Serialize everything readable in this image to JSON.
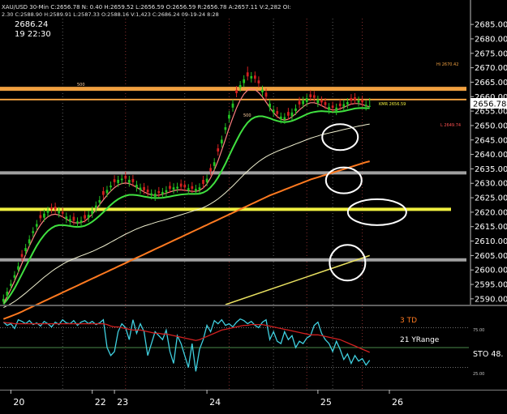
{
  "header": {
    "line1": "XAU/USD 30-Min  C:2656.78  N: 0.40  H:2659.52  L:2656.59  O:2656.59  R:2656.78  A:2657.11  V:2,282  OI:",
    "line2": "2.30  C:2588.90  H:2589.91  L:2587.33  O:2588.16  V:1,423  C:2686.24  09-19-24  8:28",
    "cursor_price": "2686.24",
    "cursor_time": "19 22:30"
  },
  "price_axis": {
    "ticks": [
      "2685.00",
      "2680.00",
      "2675.00",
      "2670.00",
      "2665.00",
      "2660.00",
      "2655.00",
      "2650.00",
      "2645.00",
      "2640.00",
      "2635.00",
      "2630.00",
      "2625.00",
      "2620.00",
      "2615.00",
      "2610.00",
      "2605.00",
      "2600.00",
      "2595.00",
      "2590.00"
    ],
    "last_price": "2656.78"
  },
  "price_annotations": {
    "high_label": "Hi 2670.42",
    "mid_label": "KMR  2656.59",
    "low_label": "L  2649.74",
    "small_label_1": "500",
    "small_label_2": "500"
  },
  "indicator": {
    "label_td": "3 TD",
    "label_range": "21 YRange",
    "label_sto": "STO  48.",
    "level_high": "75.00",
    "level_low": "25.00"
  },
  "date_axis": {
    "labels": [
      "20",
      "22",
      "23",
      "24",
      "25",
      "26"
    ]
  },
  "colors": {
    "background": "#000000",
    "up_candle": "#22c322",
    "down_candle": "#d42020",
    "grid": "#7a7a7a",
    "hline_orange": "#f0a040",
    "hline_yellow": "#f0f040",
    "hline_gray": "#a0a0a0",
    "ma_fast": "#ff8080",
    "ma_mid": "#40e040",
    "ma_slow": "#f0f0d0",
    "ma_orange": "#ff7a20",
    "ma_yellow": "#e8e060",
    "oscillator": "#40d0e0",
    "oscillator_signal": "#d02020",
    "circle": "#ffffff"
  },
  "chart_data": {
    "type": "line",
    "title": "XAU/USD 30-Min",
    "y_range": [
      2588,
      2687
    ],
    "candles": {
      "close": [
        2590.0,
        2592.5,
        2595.2,
        2598.2,
        2601.3,
        2604.5,
        2607.6,
        2610.6,
        2613.4,
        2615.9,
        2617.9,
        2619.5,
        2620.5,
        2621.0,
        2620.9,
        2620.4,
        2619.5,
        2618.5,
        2617.6,
        2617.0,
        2616.8,
        2617.1,
        2617.8,
        2619.1,
        2620.6,
        2622.3,
        2624.2,
        2626.0,
        2627.7,
        2629.2,
        2630.4,
        2631.2,
        2631.6,
        2631.6,
        2631.2,
        2630.4,
        2629.5,
        2628.5,
        2627.6,
        2626.9,
        2626.5,
        2626.4,
        2626.6,
        2627.0,
        2627.6,
        2628.1,
        2628.6,
        2628.8,
        2628.8,
        2628.6,
        2628.3,
        2628.1,
        2628.1,
        2628.6,
        2629.8,
        2631.6,
        2634.1,
        2637.3,
        2641.0,
        2645.1,
        2649.4,
        2653.7,
        2657.6,
        2661.2,
        2664.0,
        2666.0,
        2667.0,
        2667.1,
        2666.2,
        2664.6,
        2662.4,
        2660.0,
        2657.6,
        2655.5,
        2654.0,
        2653.1,
        2652.9,
        2653.4,
        2654.5,
        2655.9,
        2657.3,
        2658.6,
        2659.5,
        2659.8,
        2659.6,
        2658.9,
        2658.0,
        2657.1,
        2656.4,
        2656.1,
        2656.2,
        2656.7,
        2657.4,
        2658.1,
        2658.6,
        2658.8,
        2658.6,
        2658.0,
        2657.2,
        2656.78
      ],
      "open": [
        2589.0,
        2591.1,
        2594.5,
        2597.3,
        2600.1,
        2605.5,
        2606.5,
        2609.2,
        2612.8,
        2615.0,
        2619.0,
        2618.1,
        2619.8,
        2621.6,
        2621.9,
        2619.6,
        2620.1,
        2617.6,
        2616.7,
        2618.4,
        2616.2,
        2616.4,
        2619.0,
        2618.0,
        2619.4,
        2621.6,
        2623.3,
        2627.3,
        2626.6,
        2628.6,
        2631.4,
        2630.1,
        2631.1,
        2632.6,
        2630.2,
        2631.5,
        2628.5,
        2627.7,
        2628.7,
        2627.8,
        2625.8,
        2625.3,
        2627.3,
        2626.2,
        2626.9,
        2629.1,
        2627.8,
        2628.2,
        2629.9,
        2629.5,
        2627.5,
        2629.0,
        2627.4,
        2627.7,
        2631.2,
        2630.4,
        2635.3,
        2636.0,
        2642.1,
        2643.8,
        2648.5,
        2652.4,
        2656.2,
        2662.3,
        2663.1,
        2664.7,
        2668.4,
        2666.3,
        2667.3,
        2665.6,
        2661.5,
        2661.4,
        2656.3,
        2654.4,
        2655.0,
        2652.1,
        2652.0,
        2654.7,
        2653.2,
        2655.0,
        2658.5,
        2657.4,
        2658.1,
        2660.8,
        2660.5,
        2657.8,
        2658.7,
        2658.1,
        2655.4,
        2656.9,
        2655.0,
        2657.6,
        2656.5,
        2657.3,
        2659.5,
        2659.8,
        2658.0,
        2658.9,
        2656.6,
        2656.59
      ],
      "high": [
        2591.5,
        2593.9,
        2596.6,
        2599.6,
        2602.7,
        2606.9,
        2609.0,
        2612.0,
        2614.8,
        2617.3,
        2620.4,
        2620.9,
        2621.9,
        2623.0,
        2623.3,
        2621.8,
        2621.5,
        2619.9,
        2619.0,
        2619.8,
        2618.2,
        2618.5,
        2620.4,
        2620.5,
        2622.0,
        2623.7,
        2625.6,
        2628.7,
        2629.1,
        2630.6,
        2632.8,
        2632.6,
        2633.0,
        2634.0,
        2632.6,
        2632.9,
        2630.9,
        2629.9,
        2630.1,
        2629.2,
        2627.9,
        2627.8,
        2628.7,
        2628.4,
        2629.0,
        2630.5,
        2630.0,
        2630.2,
        2631.3,
        2630.9,
        2629.7,
        2630.4,
        2629.5,
        2630.0,
        2632.6,
        2633.0,
        2636.7,
        2638.7,
        2643.5,
        2646.5,
        2650.8,
        2655.1,
        2659.0,
        2663.7,
        2665.4,
        2667.4,
        2670.4,
        2668.5,
        2668.7,
        2667.0,
        2663.8,
        2662.8,
        2659.0,
        2656.9,
        2656.4,
        2654.5,
        2654.3,
        2656.1,
        2655.9,
        2657.3,
        2659.9,
        2660.0,
        2660.9,
        2662.2,
        2661.9,
        2660.3,
        2660.1,
        2659.5,
        2657.8,
        2658.3,
        2657.6,
        2659.0,
        2658.8,
        2659.5,
        2660.9,
        2661.2,
        2660.0,
        2660.3,
        2658.6,
        2659.52
      ],
      "low": [
        2588.2,
        2590.1,
        2593.3,
        2596.3,
        2599.0,
        2603.1,
        2605.1,
        2608.2,
        2611.4,
        2613.6,
        2616.5,
        2616.7,
        2618.4,
        2619.6,
        2619.5,
        2618.2,
        2618.1,
        2616.2,
        2615.3,
        2615.6,
        2614.8,
        2615.0,
        2616.4,
        2616.6,
        2618.0,
        2619.9,
        2621.9,
        2624.6,
        2625.2,
        2627.2,
        2629.0,
        2628.7,
        2629.7,
        2630.2,
        2628.8,
        2628.9,
        2627.1,
        2626.3,
        2626.2,
        2625.5,
        2624.4,
        2623.9,
        2625.2,
        2624.8,
        2625.5,
        2626.7,
        2626.4,
        2626.8,
        2627.4,
        2627.2,
        2626.1,
        2626.7,
        2626.0,
        2626.3,
        2628.4,
        2629.0,
        2632.7,
        2634.6,
        2639.6,
        2642.4,
        2647.1,
        2651.0,
        2654.8,
        2659.8,
        2661.7,
        2663.3,
        2665.6,
        2664.9,
        2664.8,
        2663.2,
        2660.1,
        2658.6,
        2654.9,
        2653.0,
        2652.6,
        2650.7,
        2650.6,
        2652.0,
        2651.8,
        2653.6,
        2655.9,
        2656.0,
        2656.7,
        2658.4,
        2658.2,
        2656.4,
        2656.6,
        2655.7,
        2654.0,
        2654.7,
        2653.6,
        2655.3,
        2655.1,
        2655.9,
        2657.2,
        2657.4,
        2656.6,
        2656.6,
        2655.2,
        2656.59
      ]
    },
    "moving_averages": {
      "ma_fast": [
        2588.5,
        2590.8,
        2593.4,
        2596.2,
        2599.2,
        2602.3,
        2605.3,
        2608.3,
        2611.0,
        2613.5,
        2615.6,
        2617.3,
        2618.4,
        2619.1,
        2619.3,
        2619.0,
        2618.4,
        2617.6,
        2616.9,
        2616.4,
        2616.2,
        2616.4,
        2616.9,
        2618.0,
        2619.3,
        2620.9,
        2622.6,
        2624.3,
        2625.9,
        2627.3,
        2628.5,
        2629.4,
        2629.9,
        2630.1,
        2629.9,
        2629.3,
        2628.6,
        2627.8,
        2627.0,
        2626.4,
        2626.0,
        2625.8,
        2625.9,
        2626.2,
        2626.6,
        2627.0,
        2627.4,
        2627.7,
        2627.7,
        2627.6,
        2627.4,
        2627.2,
        2627.2,
        2627.5,
        2628.4,
        2629.8,
        2631.9,
        2634.6,
        2637.8,
        2641.4,
        2645.2,
        2649.1,
        2652.7,
        2656.1,
        2658.8,
        2660.9,
        2662.2,
        2662.7,
        2662.4,
        2661.4,
        2659.9,
        2658.1,
        2656.2,
        2654.4,
        2653.1,
        2652.2,
        2651.9,
        2652.2,
        2653.0,
        2654.1,
        2655.4,
        2656.5,
        2657.4,
        2657.9,
        2657.9,
        2657.5,
        2656.9,
        2656.2,
        2655.7,
        2655.4,
        2655.4,
        2655.8,
        2656.3,
        2656.9,
        2657.4,
        2657.6,
        2657.6,
        2657.3,
        2656.8,
        2656.5
      ],
      "ma_mid": [
        2588.2,
        2589.7,
        2591.6,
        2593.7,
        2596.1,
        2598.6,
        2601.1,
        2603.6,
        2606.1,
        2608.4,
        2610.4,
        2612.1,
        2613.5,
        2614.5,
        2615.2,
        2615.5,
        2615.5,
        2615.4,
        2615.2,
        2615.0,
        2614.9,
        2615.0,
        2615.3,
        2615.9,
        2616.7,
        2617.7,
        2618.8,
        2620.0,
        2621.3,
        2622.5,
        2623.6,
        2624.5,
        2625.2,
        2625.7,
        2626.0,
        2626.0,
        2625.9,
        2625.7,
        2625.4,
        2625.2,
        2625.0,
        2624.9,
        2624.9,
        2625.0,
        2625.2,
        2625.4,
        2625.7,
        2625.9,
        2626.1,
        2626.2,
        2626.3,
        2626.3,
        2626.3,
        2626.4,
        2626.8,
        2627.5,
        2628.6,
        2630.1,
        2632.0,
        2634.3,
        2636.8,
        2639.5,
        2642.2,
        2644.8,
        2647.2,
        2649.3,
        2651.0,
        2652.2,
        2652.9,
        2653.2,
        2653.2,
        2652.9,
        2652.5,
        2652.0,
        2651.6,
        2651.3,
        2651.2,
        2651.3,
        2651.6,
        2652.1,
        2652.7,
        2653.3,
        2653.9,
        2654.4,
        2654.7,
        2654.9,
        2655.0,
        2654.9,
        2654.8,
        2654.7,
        2654.7,
        2654.8,
        2655.0,
        2655.3,
        2655.6,
        2655.9,
        2656.0,
        2656.1,
        2656.0,
        2656.0
      ],
      "ma_slow": [
        2587.0,
        2587.6,
        2588.3,
        2589.1,
        2590.0,
        2591.0,
        2592.0,
        2593.1,
        2594.2,
        2595.3,
        2596.4,
        2597.5,
        2598.5,
        2599.5,
        2600.4,
        2601.2,
        2602.0,
        2602.7,
        2603.3,
        2603.9,
        2604.4,
        2604.9,
        2605.4,
        2605.9,
        2606.4,
        2607.0,
        2607.6,
        2608.2,
        2608.9,
        2609.6,
        2610.3,
        2611.0,
        2611.7,
        2612.4,
        2613.0,
        2613.6,
        2614.2,
        2614.7,
        2615.2,
        2615.6,
        2616.0,
        2616.4,
        2616.8,
        2617.1,
        2617.5,
        2617.9,
        2618.3,
        2618.7,
        2619.1,
        2619.5,
        2619.9,
        2620.3,
        2620.7,
        2621.1,
        2621.6,
        2622.2,
        2622.9,
        2623.7,
        2624.6,
        2625.6,
        2626.7,
        2627.9,
        2629.1,
        2630.4,
        2631.7,
        2633.0,
        2634.2,
        2635.4,
        2636.5,
        2637.5,
        2638.4,
        2639.2,
        2639.9,
        2640.5,
        2641.1,
        2641.6,
        2642.1,
        2642.6,
        2643.1,
        2643.6,
        2644.1,
        2644.6,
        2645.1,
        2645.6,
        2646.0,
        2646.4,
        2646.8,
        2647.1,
        2647.4,
        2647.7,
        2648.0,
        2648.3,
        2648.6,
        2648.9,
        2649.2,
        2649.5,
        2649.8,
        2650.0,
        2650.3,
        2650.5
      ],
      "ma_orange": [
        2583.0,
        2583.5,
        2584.0,
        2584.5,
        2585.0,
        2585.6,
        2586.2,
        2586.8,
        2587.4,
        2588.0,
        2588.6,
        2589.2,
        2589.8,
        2590.4,
        2591.0,
        2591.6,
        2592.2,
        2592.8,
        2593.4,
        2594.0,
        2594.6,
        2595.2,
        2595.8,
        2596.4,
        2597.0,
        2597.6,
        2598.2,
        2598.8,
        2599.4,
        2600.0,
        2600.6,
        2601.2,
        2601.8,
        2602.4,
        2603.0,
        2603.6,
        2604.2,
        2604.8,
        2605.4,
        2606.0,
        2606.6,
        2607.2,
        2607.8,
        2608.4,
        2609.0,
        2609.6,
        2610.2,
        2610.8,
        2611.4,
        2612.0,
        2612.6,
        2613.2,
        2613.8,
        2614.4,
        2615.0,
        2615.6,
        2616.2,
        2616.8,
        2617.4,
        2618.0,
        2618.6,
        2619.2,
        2619.8,
        2620.4,
        2621.0,
        2621.6,
        2622.2,
        2622.8,
        2623.4,
        2624.0,
        2624.6,
        2625.2,
        2625.8,
        2626.3,
        2626.8,
        2627.3,
        2627.8,
        2628.3,
        2628.8,
        2629.3,
        2629.8,
        2630.3,
        2630.8,
        2631.3,
        2631.7,
        2632.1,
        2632.5,
        2632.9,
        2633.3,
        2633.7,
        2634.1,
        2634.5,
        2634.9,
        2635.3,
        2635.7,
        2636.1,
        2636.5,
        2636.9,
        2637.3,
        2637.6
      ],
      "ma_yellow_line": {
        "x_start": 60,
        "y_start": 2588.0,
        "x_end": 99,
        "y_end": 2605.0
      }
    },
    "horizontal_lines": [
      {
        "price": 2662.7,
        "color": "orange",
        "width": 5
      },
      {
        "price": 2659.0,
        "color": "orange",
        "width": 2
      },
      {
        "price": 2633.6,
        "color": "gray",
        "width": 4
      },
      {
        "price": 2621.0,
        "color": "yellow",
        "width": 4
      },
      {
        "price": 2603.5,
        "color": "gray",
        "width": 4
      }
    ],
    "circles": [
      {
        "x_index": 91,
        "price": 2646.0
      },
      {
        "x_index": 92,
        "price": 2631.0
      },
      {
        "x_index": 101,
        "price": 2620.0
      },
      {
        "x_index": 93,
        "price": 2602.5
      }
    ],
    "oscillator": {
      "range": [
        0,
        100
      ],
      "levels": [
        75,
        25
      ],
      "main": [
        82,
        78,
        80,
        74,
        85,
        83,
        80,
        84,
        79,
        81,
        77,
        83,
        80,
        76,
        82,
        79,
        85,
        81,
        80,
        84,
        78,
        82,
        84,
        80,
        83,
        79,
        81,
        85,
        50,
        40,
        45,
        70,
        80,
        75,
        60,
        85,
        68,
        80,
        70,
        40,
        55,
        70,
        65,
        60,
        72,
        45,
        30,
        65,
        55,
        40,
        25,
        55,
        20,
        48,
        60,
        78,
        70,
        84,
        80,
        85,
        78,
        80,
        76,
        82,
        86,
        84,
        80,
        83,
        78,
        75,
        82,
        85,
        60,
        70,
        58,
        55,
        70,
        60,
        65,
        50,
        58,
        55,
        62,
        65,
        78,
        82,
        68,
        60,
        55,
        45,
        58,
        48,
        35,
        42,
        30,
        40,
        33,
        36,
        28,
        34
      ],
      "signal": [
        82,
        81,
        81,
        80,
        80,
        80,
        80,
        80,
        80,
        80,
        80,
        80,
        80,
        80,
        80,
        80,
        80,
        80,
        80,
        80,
        80,
        80,
        80,
        80,
        80,
        80,
        80,
        80,
        79,
        77,
        76,
        76,
        75,
        74,
        73,
        72,
        72,
        72,
        71,
        70,
        69,
        68,
        68,
        67,
        67,
        66,
        65,
        64,
        63,
        62,
        61,
        60,
        59,
        60,
        62,
        64,
        66,
        68,
        70,
        72,
        73,
        74,
        75,
        76,
        77,
        78,
        78,
        79,
        79,
        79,
        79,
        78,
        77,
        76,
        75,
        74,
        73,
        72,
        71,
        70,
        69,
        68,
        67,
        66,
        66,
        66,
        65,
        64,
        63,
        62,
        61,
        60,
        58,
        56,
        54,
        52,
        50,
        48,
        46,
        44
      ]
    }
  }
}
